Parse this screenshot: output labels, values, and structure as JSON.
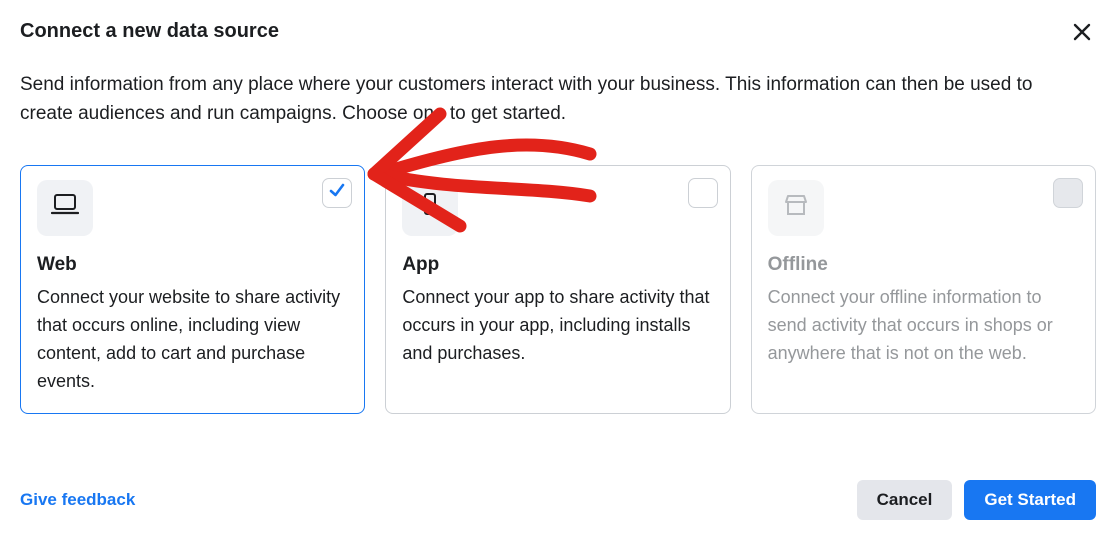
{
  "header": {
    "title": "Connect a new data source",
    "description": "Send information from any place where your customers interact with your business. This information can then be used to create audiences and run campaigns. Choose one to get started."
  },
  "cards": {
    "web": {
      "title": "Web",
      "description": "Connect your website to share activity that occurs online, including view content, add to cart and purchase events.",
      "selected": true
    },
    "app": {
      "title": "App",
      "description": "Connect your app to share activity that occurs in your app, including installs and purchases.",
      "selected": false
    },
    "offline": {
      "title": "Offline",
      "description": "Connect your offline information to send activity that occurs in shops or anywhere that is not on the web.",
      "selected": false,
      "disabled": true
    }
  },
  "footer": {
    "feedback_label": "Give feedback",
    "cancel_label": "Cancel",
    "get_started_label": "Get Started"
  }
}
